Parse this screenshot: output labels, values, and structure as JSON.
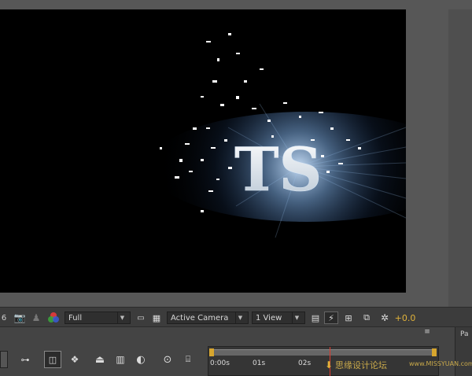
{
  "composition": {
    "text": "TS"
  },
  "viewer_controls": {
    "magnification_partial": "6",
    "resolution": "Full",
    "camera_view": "Active Camera",
    "view_layout": "1 View",
    "exposure_value": "+0.0"
  },
  "timeline": {
    "panel_menu_label": "≡",
    "ruler_ticks": [
      "0:00s",
      "01s",
      "02s"
    ],
    "side_panel_label": "Pa"
  },
  "watermark": {
    "text": "思缘设计论坛",
    "url_text": "www.MISSYUAN.com"
  },
  "colors": {
    "accent_gold": "#e0b23a",
    "playhead_red": "#e03b2f"
  }
}
